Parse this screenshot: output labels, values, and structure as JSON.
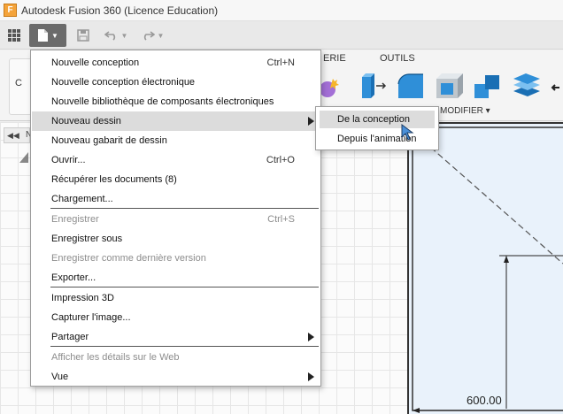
{
  "window": {
    "title": "Autodesk Fusion 360 (Licence Education)",
    "logo_letter": "F"
  },
  "qat": {
    "icons": [
      "grid-icon",
      "file-icon",
      "save-icon",
      "undo-icon",
      "redo-icon"
    ]
  },
  "ribbon": {
    "panel_letter": "C",
    "label_erie": "ERIE",
    "label_outils": "OUTILS",
    "label_modifier": "MODIFIER ▾"
  },
  "file_menu": {
    "items": [
      {
        "label": "Nouvelle conception",
        "shortcut": "Ctrl+N"
      },
      {
        "label": "Nouvelle conception électronique",
        "shortcut": ""
      },
      {
        "label": "Nouvelle bibliothèque de composants électroniques",
        "shortcut": ""
      },
      {
        "label": "Nouveau dessin",
        "shortcut": ""
      },
      {
        "label": "Nouveau gabarit de dessin",
        "shortcut": ""
      },
      {
        "label": "Ouvrir...",
        "shortcut": "Ctrl+O"
      },
      {
        "label": "Récupérer les documents (8)",
        "shortcut": ""
      },
      {
        "label": "Chargement...",
        "shortcut": ""
      },
      {
        "label": "Enregistrer",
        "shortcut": "Ctrl+S"
      },
      {
        "label": "Enregistrer sous",
        "shortcut": ""
      },
      {
        "label": "Enregistrer comme dernière version",
        "shortcut": ""
      },
      {
        "label": "Exporter...",
        "shortcut": ""
      },
      {
        "label": "Impression 3D",
        "shortcut": ""
      },
      {
        "label": "Capturer l'image...",
        "shortcut": ""
      },
      {
        "label": "Partager",
        "shortcut": ""
      },
      {
        "label": "Afficher les détails sur le Web",
        "shortcut": ""
      },
      {
        "label": "Vue",
        "shortcut": ""
      }
    ]
  },
  "submenu": {
    "items": [
      {
        "label": "De la conception"
      },
      {
        "label": "Depuis l'animation"
      }
    ]
  },
  "canvas": {
    "browser_toggle": "◀◀",
    "browser_letter": "N",
    "dimension": "600.00"
  }
}
